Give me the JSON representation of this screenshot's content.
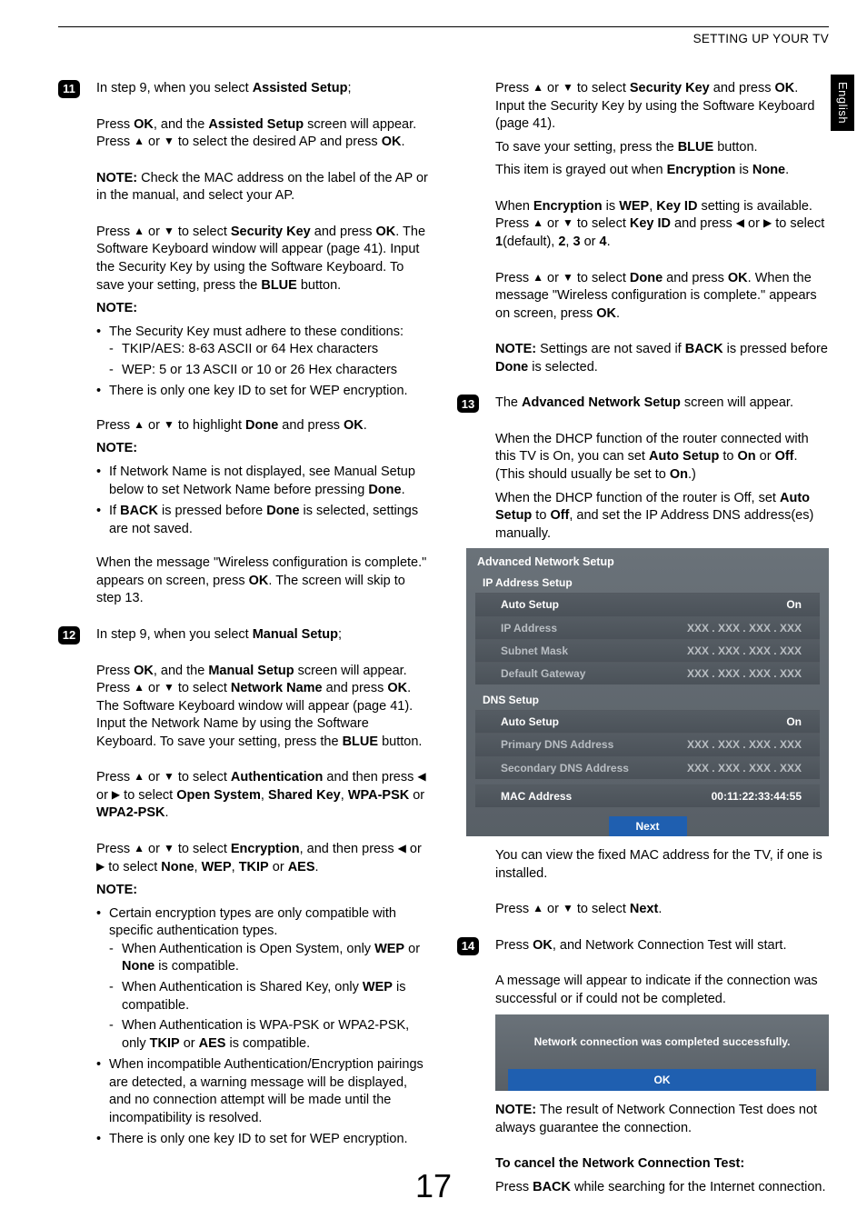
{
  "header": {
    "section": "SETTING UP YOUR TV",
    "lang_tab": "English"
  },
  "page_number": "17",
  "glyph": {
    "up": "▲",
    "down": "▼",
    "left": "◀",
    "right": "▶"
  },
  "steps": {
    "s11": {
      "num": "11",
      "intro_a": "In step 9, when you select ",
      "intro_b": "Assisted Setup",
      "intro_c": ";",
      "p1a": "Press ",
      "p1b": "OK",
      "p1c": ", and the ",
      "p1d": "Assisted Setup",
      "p1e": " screen will appear. Press ",
      "p1f": " or ",
      "p1g": " to select the desired AP and press ",
      "p1h": "OK",
      "p1i": ".",
      "note1a": "NOTE:",
      "note1b": " Check the MAC address on the label of the AP or in the manual, and select your AP.",
      "p2a": "Press ",
      "p2b": " or ",
      "p2c": " to select ",
      "p2d": "Security Key",
      "p2e": " and press ",
      "p2f": "OK",
      "p2g": ". The Software Keyboard window will appear (page 41). Input the Security Key by using the Software Keyboard. To save your setting, press the ",
      "p2h": "BLUE",
      "p2i": " button.",
      "note2h": "NOTE:",
      "n2_li1": "The Security Key must adhere to these conditions:",
      "n2_li1a": "TKIP/AES: 8-63 ASCII or 64 Hex characters",
      "n2_li1b": "WEP: 5 or 13 ASCII or 10 or 26 Hex characters",
      "n2_li2": "There is only one key ID to set for WEP encryption.",
      "p3a": "Press ",
      "p3b": " or ",
      "p3c": " to highlight ",
      "p3d": "Done",
      "p3e": " and press ",
      "p3f": "OK",
      "p3g": ".",
      "note3h": "NOTE:",
      "n3_li1a": "If Network Name is not displayed, see Manual Setup below to set Network Name before pressing ",
      "n3_li1b": "Done",
      "n3_li1c": ".",
      "n3_li2a": "If ",
      "n3_li2b": "BACK",
      "n3_li2c": " is pressed before ",
      "n3_li2d": "Done",
      "n3_li2e": " is selected, settings are not saved.",
      "p4a": "When the message \"Wireless configuration is complete.\" appears on screen, press ",
      "p4b": "OK",
      "p4c": ". The screen will skip to step 13."
    },
    "s12": {
      "num": "12",
      "intro_a": "In step 9, when you select ",
      "intro_b": "Manual Setup",
      "intro_c": ";",
      "p1a": "Press ",
      "p1b": "OK",
      "p1c": ", and the ",
      "p1d": "Manual Setup",
      "p1e": " screen will appear. Press ",
      "p1f": " or ",
      "p1g": " to select ",
      "p1h": "Network Name",
      "p1i": " and press ",
      "p1j": "OK",
      "p1k": ". The Software Keyboard window will appear (page 41). Input the Network Name by using the Software Keyboard. To save your setting, press the ",
      "p1l": "BLUE",
      "p1m": " button.",
      "p2a": "Press ",
      "p2b": " or ",
      "p2c": " to select ",
      "p2d": "Authentication",
      "p2e": " and then press ",
      "p2f": " or ",
      "p2g": " to select ",
      "p2h": "Open System",
      "p2i": ", ",
      "p2j": "Shared Key",
      "p2k": ", ",
      "p2l": "WPA-PSK",
      "p2m": " or ",
      "p2n": "WPA2-PSK",
      "p2o": ".",
      "p3a": "Press ",
      "p3b": " or ",
      "p3c": " to select ",
      "p3d": "Encryption",
      "p3e": ", and then press ",
      "p3f": " or ",
      "p3g": " to select ",
      "p3h": "None",
      "p3i": ", ",
      "p3j": "WEP",
      "p3k": ", ",
      "p3l": "TKIP",
      "p3m": " or ",
      "p3n": "AES",
      "p3o": ".",
      "note1h": "NOTE:",
      "n1_li1": "Certain encryption types are only compatible with specific authentication types.",
      "n1_li1a_a": "When Authentication is Open System, only ",
      "n1_li1a_b": "WEP",
      "n1_li1a_c": " or ",
      "n1_li1a_d": "None",
      "n1_li1a_e": " is compatible.",
      "n1_li1b_a": "When Authentication is Shared Key, only ",
      "n1_li1b_b": "WEP",
      "n1_li1b_c": " is compatible.",
      "n1_li1c_a": "When Authentication is WPA-PSK or WPA2-PSK, only ",
      "n1_li1c_b": "TKIP",
      "n1_li1c_c": " or ",
      "n1_li1c_d": "AES",
      "n1_li1c_e": " is compatible.",
      "n1_li2": "When incompatible Authentication/Encryption pairings are detected, a warning message will be displayed, and no connection attempt will be made until the incompatibility is resolved.",
      "n1_li3": "There is only one key ID to set for WEP encryption."
    },
    "s12r": {
      "p1a": "Press ",
      "p1b": " or ",
      "p1c": " to select ",
      "p1d": "Security Key",
      "p1e": " and press ",
      "p1f": "OK",
      "p1g": ". Input the Security Key by using the Software Keyboard (page 41).",
      "p1h": "To save your setting, press the ",
      "p1i": "BLUE",
      "p1j": " button.",
      "p1k": "This item is grayed out when ",
      "p1l": "Encryption",
      "p1m": " is ",
      "p1n": "None",
      "p1o": ".",
      "p2a": "When ",
      "p2b": "Encryption",
      "p2c": " is ",
      "p2d": "WEP",
      "p2e": ", ",
      "p2f": "Key ID",
      "p2g": " setting is available. Press ",
      "p2h": " or ",
      "p2i": " to select ",
      "p2j": "Key ID",
      "p2k": " and press ",
      "p2l": " or ",
      "p2m": " to select ",
      "p2n": "1",
      "p2o": "(default), ",
      "p2p": "2",
      "p2q": ", ",
      "p2r": "3",
      "p2s": " or ",
      "p2t": "4",
      "p2u": ".",
      "p3a": "Press ",
      "p3b": " or ",
      "p3c": " to select ",
      "p3d": "Done",
      "p3e": " and press ",
      "p3f": "OK",
      "p3g": ". When the message \"Wireless configuration is complete.\" appears on screen, press ",
      "p3h": "OK",
      "p3i": ".",
      "note_a": "NOTE:",
      "note_b": " Settings are not saved if ",
      "note_c": "BACK",
      "note_d": " is pressed before ",
      "note_e": "Done",
      "note_f": " is selected."
    },
    "s13": {
      "num": "13",
      "p1a": "The ",
      "p1b": "Advanced Network Setup",
      "p1c": " screen will appear.",
      "p2a": "When the DHCP function of the router connected with this TV is On, you can set ",
      "p2b": "Auto Setup",
      "p2c": " to ",
      "p2d": "On",
      "p2e": " or ",
      "p2f": "Off",
      "p2g": ". (This should usually be set to ",
      "p2h": "On",
      "p2i": ".)",
      "p2j": "When the DHCP function of the router is Off, set ",
      "p2k": "Auto Setup",
      "p2l": " to ",
      "p2m": "Off",
      "p2n": ", and set the IP Address DNS address(es) manually.",
      "after1": "You can view the fixed MAC address for the TV, if one is installed.",
      "after2a": "Press ",
      "after2b": " or ",
      "after2c": " to select ",
      "after2d": "Next",
      "after2e": "."
    },
    "s14": {
      "num": "14",
      "p1a": "Press ",
      "p1b": "OK",
      "p1c": ", and Network Connection Test will start.",
      "p2": "A message will appear to indicate if the connection was successful or if could not be completed.",
      "note_a": "NOTE:",
      "note_b": " The result of Network Connection Test does not always guarantee the connection.",
      "cancel_h": "To cancel the Network Connection Test:",
      "cancel_a": "Press ",
      "cancel_b": "BACK",
      "cancel_c": " while searching for the Internet connection."
    }
  },
  "osd_adv": {
    "title": "Advanced Network Setup",
    "ip_title": "IP Address Setup",
    "rows_ip": [
      {
        "label": "Auto Setup",
        "val": "On",
        "dim": false
      },
      {
        "label": "IP Address",
        "val": "XXX . XXX . XXX . XXX",
        "dim": true
      },
      {
        "label": "Subnet Mask",
        "val": "XXX . XXX . XXX . XXX",
        "dim": true
      },
      {
        "label": "Default Gateway",
        "val": "XXX . XXX . XXX . XXX",
        "dim": true
      }
    ],
    "dns_title": "DNS Setup",
    "rows_dns": [
      {
        "label": "Auto Setup",
        "val": "On",
        "dim": false
      },
      {
        "label": "Primary DNS Address",
        "val": "XXX . XXX . XXX . XXX",
        "dim": true
      },
      {
        "label": "Secondary DNS Address",
        "val": "XXX . XXX . XXX . XXX",
        "dim": true
      }
    ],
    "mac": {
      "label": "MAC Address",
      "val": "00:11:22:33:44:55"
    },
    "next": "Next"
  },
  "osd_msg": {
    "text": "Network connection was completed successfully.",
    "ok": "OK"
  }
}
